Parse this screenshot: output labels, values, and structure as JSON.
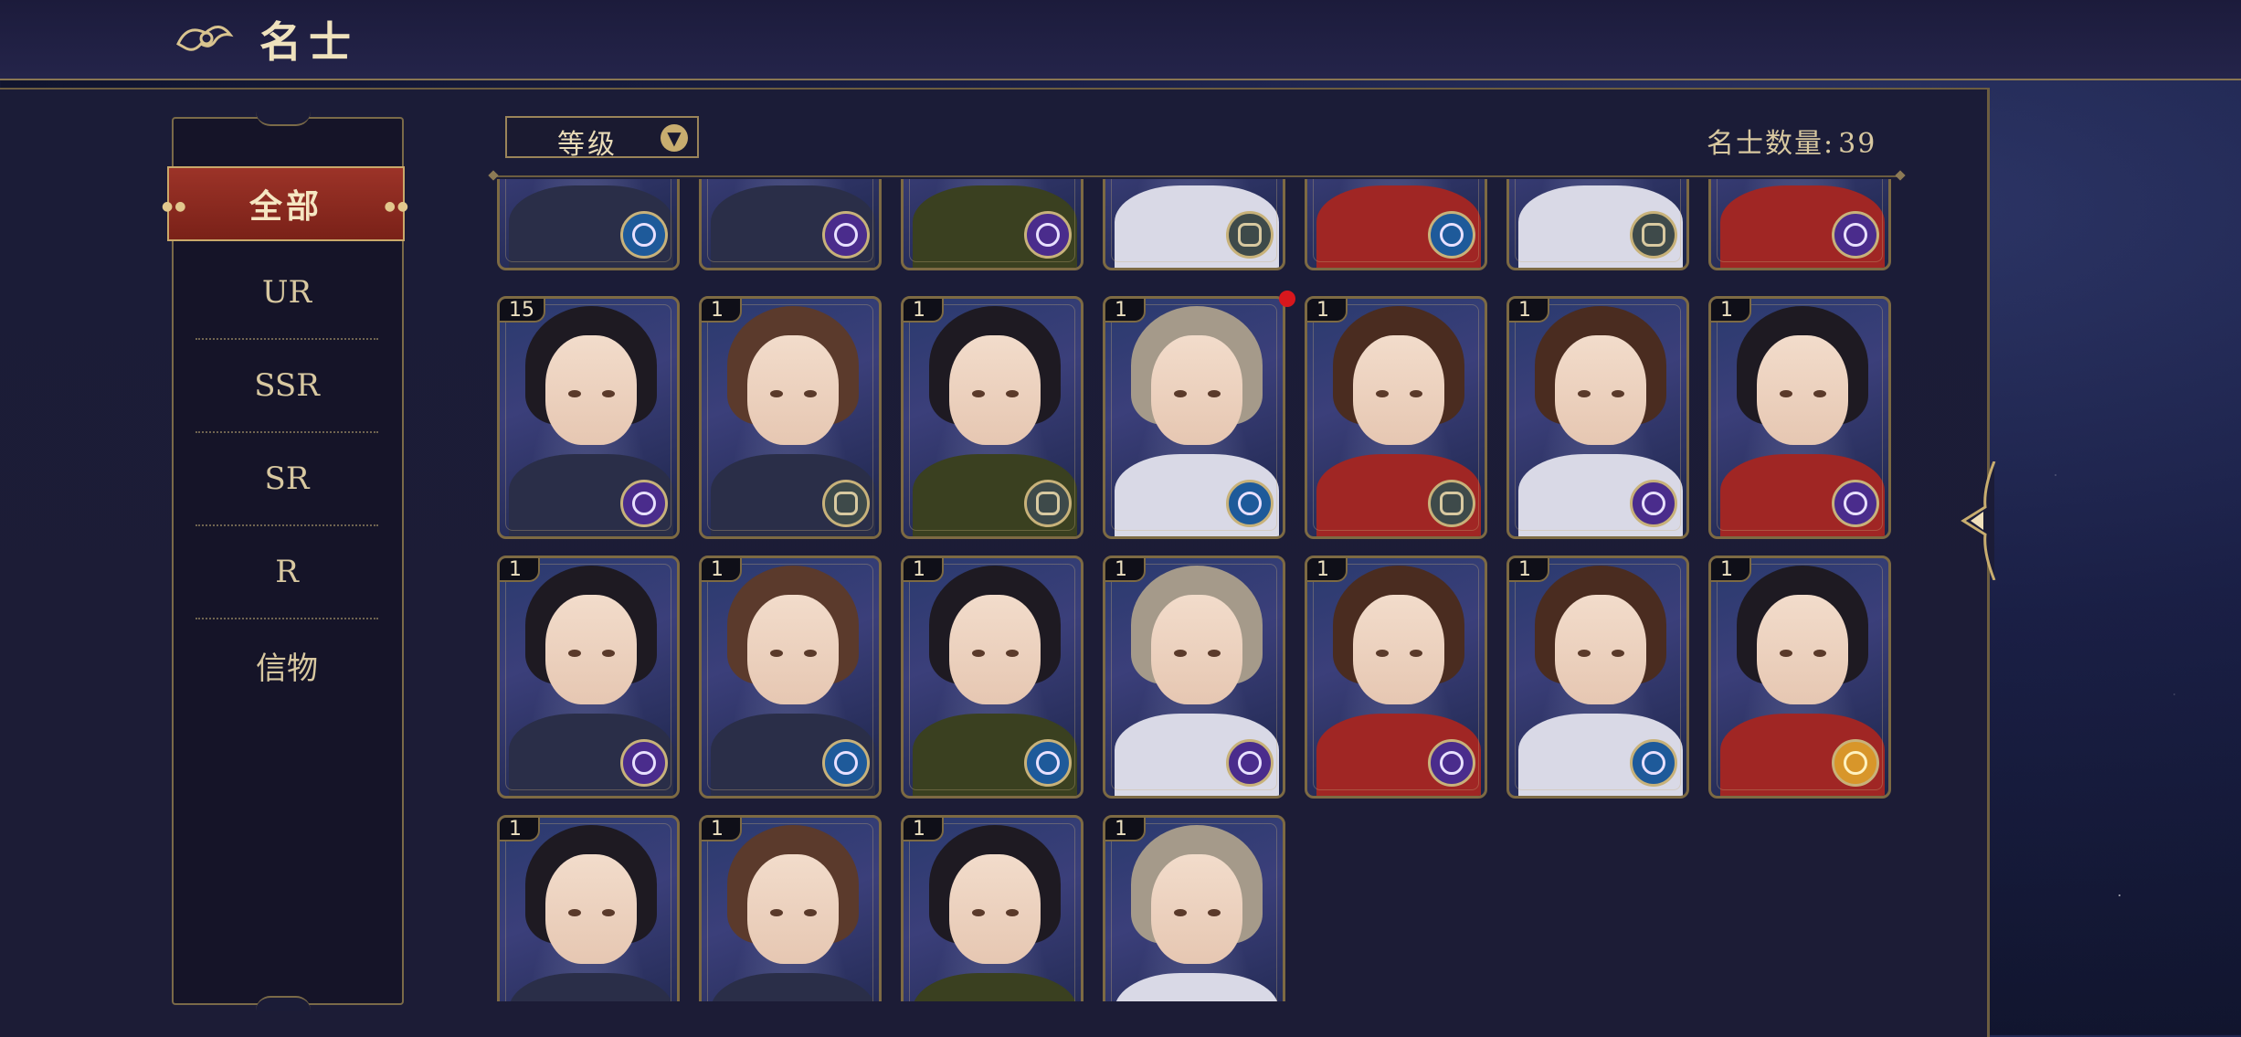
{
  "header": {
    "title": "名士"
  },
  "sidebar": {
    "categories": [
      {
        "label": "全部",
        "active": true
      },
      {
        "label": "UR"
      },
      {
        "label": "SSR"
      },
      {
        "label": "SR"
      },
      {
        "label": "R"
      },
      {
        "label": "信物"
      }
    ]
  },
  "toolbar": {
    "sort_label": "等级",
    "count_label": "名士数量:",
    "count_value": "39"
  },
  "cards": [
    {
      "level": "",
      "faction": "blue"
    },
    {
      "level": "",
      "faction": "purple"
    },
    {
      "level": "",
      "faction": "purple"
    },
    {
      "level": "",
      "faction": "gray"
    },
    {
      "level": "",
      "faction": "blue"
    },
    {
      "level": "",
      "faction": "gray"
    },
    {
      "level": "",
      "faction": "purple"
    },
    {
      "level": "15",
      "faction": "purple"
    },
    {
      "level": "1",
      "faction": "gray"
    },
    {
      "level": "1",
      "faction": "gray"
    },
    {
      "level": "1",
      "faction": "blue",
      "new": true
    },
    {
      "level": "1",
      "faction": "gray"
    },
    {
      "level": "1",
      "faction": "purple"
    },
    {
      "level": "1",
      "faction": "purple"
    },
    {
      "level": "1",
      "faction": "purple"
    },
    {
      "level": "1",
      "faction": "blue"
    },
    {
      "level": "1",
      "faction": "blue"
    },
    {
      "level": "1",
      "faction": "purple"
    },
    {
      "level": "1",
      "faction": "purple"
    },
    {
      "level": "1",
      "faction": "blue"
    },
    {
      "level": "1",
      "faction": "gold"
    },
    {
      "level": "1",
      "faction": ""
    },
    {
      "level": "1",
      "faction": ""
    },
    {
      "level": "1",
      "faction": ""
    },
    {
      "level": "1",
      "faction": ""
    }
  ]
}
